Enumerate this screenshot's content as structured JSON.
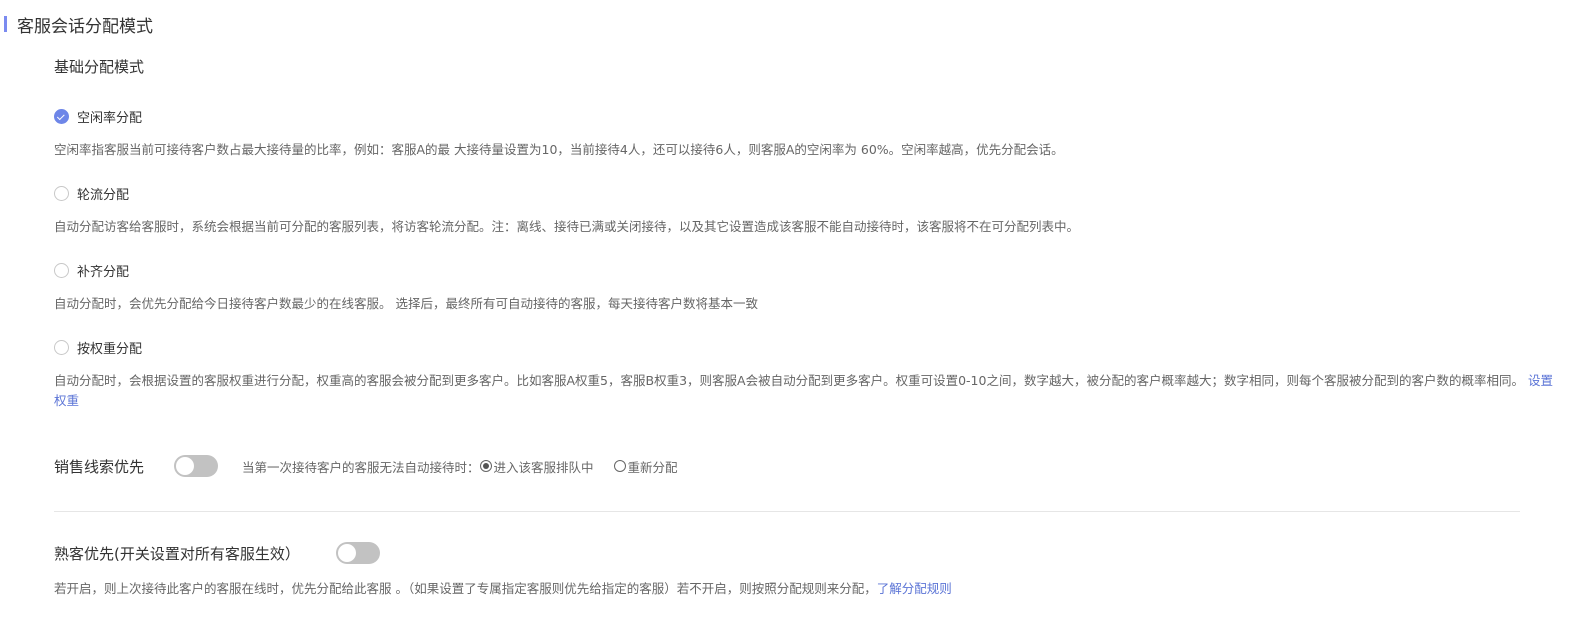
{
  "header": {
    "title": "客服会话分配模式"
  },
  "basic": {
    "title": "基础分配模式",
    "options": [
      {
        "label": "空闲率分配",
        "checked": true,
        "desc": "空闲率指客服当前可接待客户数占最大接待量的比率，例如：客服A的最 大接待量设置为10，当前接待4人，还可以接待6人，则客服A的空闲率为 60%。空闲率越高，优先分配会话。"
      },
      {
        "label": "轮流分配",
        "checked": false,
        "desc": "自动分配访客给客服时，系统会根据当前可分配的客服列表，将访客轮流分配。注：离线、接待已满或关闭接待，以及其它设置造成该客服不能自动接待时，该客服将不在可分配列表中。"
      },
      {
        "label": "补齐分配",
        "checked": false,
        "desc": "自动分配时，会优先分配给今日接待客户数最少的在线客服。 选择后，最终所有可自动接待的客服，每天接待客户数将基本一致"
      },
      {
        "label": "按权重分配",
        "checked": false,
        "desc": "自动分配时，会根据设置的客服权重进行分配，权重高的客服会被分配到更多客户。比如客服A权重5，客服B权重3，则客服A会被自动分配到更多客户。权重可设置0-10之间，数字越大，被分配的客户概率越大；数字相同，则每个客服被分配到的客户数的概率相同。",
        "link": "设置权重"
      }
    ]
  },
  "sales": {
    "label": "销售线索优先",
    "toggle_on": false,
    "hint": "当第一次接待客户的客服无法自动接待时：",
    "radio_queue": "进入该客服排队中",
    "radio_reassign": "重新分配",
    "selected": "queue"
  },
  "familiar": {
    "label": "熟客优先(开关设置对所有客服生效）",
    "toggle_on": false,
    "desc": "若开启，则上次接待此客户的客服在线时，优先分配给此客服 。（如果设置了专属指定客服则优先给指定的客服）若不开启，则按照分配规则来分配，",
    "link": "了解分配规则"
  },
  "colors": {
    "accent": "#6e86e8",
    "link": "#5b74d6",
    "toggle_off": "#c2c2c2"
  }
}
